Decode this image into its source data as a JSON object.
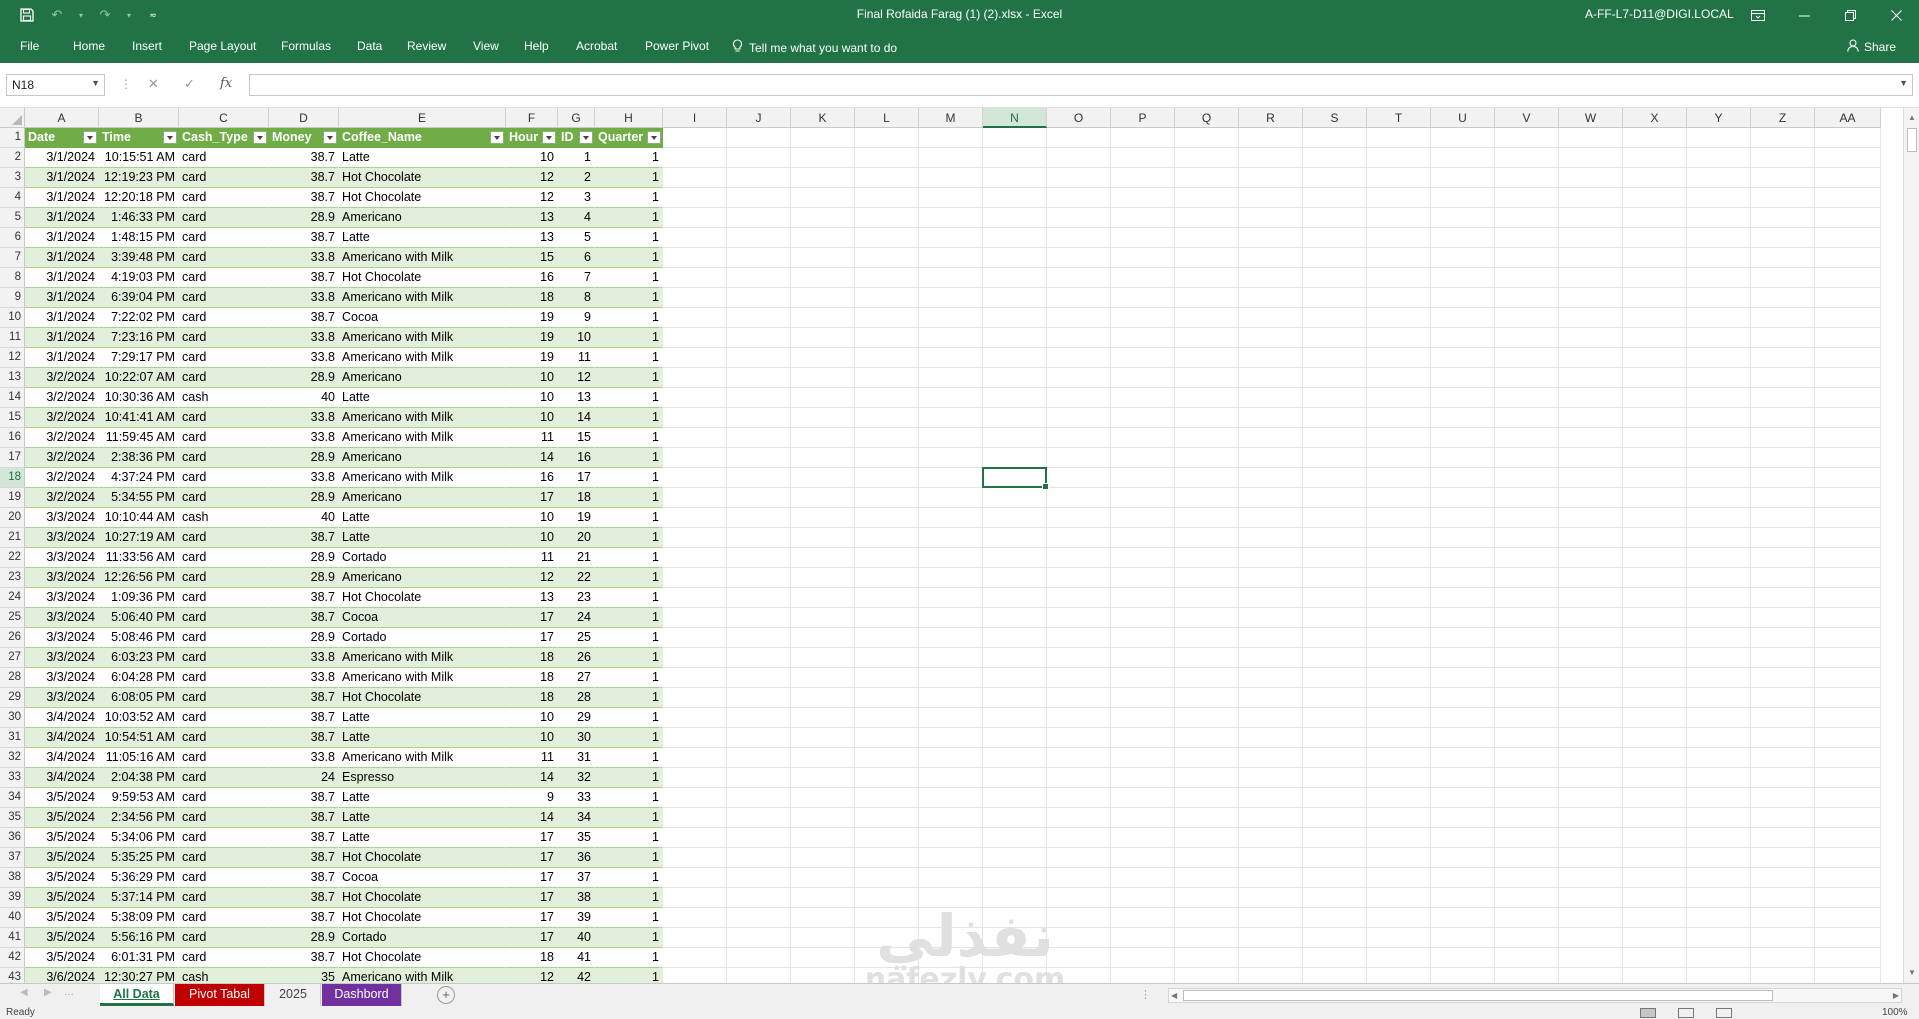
{
  "window": {
    "title": "Final Rofaida Farag (1) (2).xlsx  -  Excel",
    "user": "A-FF-L7-D11@DIGI.LOCAL"
  },
  "ribbon": {
    "tabs": [
      "File",
      "Home",
      "Insert",
      "Page Layout",
      "Formulas",
      "Data",
      "Review",
      "View",
      "Help",
      "Acrobat",
      "Power Pivot"
    ],
    "tell_me": "Tell me what you want to do",
    "share": "Share"
  },
  "formula_bar": {
    "name_box": "N18",
    "formula": ""
  },
  "columns": [
    "A",
    "B",
    "C",
    "D",
    "E",
    "F",
    "G",
    "H",
    "I",
    "J",
    "K",
    "L",
    "M",
    "N",
    "O",
    "P",
    "Q",
    "R",
    "S",
    "T",
    "U",
    "V",
    "W",
    "X",
    "Y",
    "Z",
    "AA"
  ],
  "selected_cell": "N18",
  "table": {
    "headers": [
      "Date",
      "Time",
      "Cash_Type",
      "Money",
      "Coffee_Name",
      "Hour",
      "ID",
      "Quarter"
    ],
    "rows": [
      [
        "3/1/2024",
        "10:15:51 AM",
        "card",
        "38.7",
        "Latte",
        "10",
        "1",
        "1"
      ],
      [
        "3/1/2024",
        "12:19:23 PM",
        "card",
        "38.7",
        "Hot Chocolate",
        "12",
        "2",
        "1"
      ],
      [
        "3/1/2024",
        "12:20:18 PM",
        "card",
        "38.7",
        "Hot Chocolate",
        "12",
        "3",
        "1"
      ],
      [
        "3/1/2024",
        "1:46:33 PM",
        "card",
        "28.9",
        "Americano",
        "13",
        "4",
        "1"
      ],
      [
        "3/1/2024",
        "1:48:15 PM",
        "card",
        "38.7",
        "Latte",
        "13",
        "5",
        "1"
      ],
      [
        "3/1/2024",
        "3:39:48 PM",
        "card",
        "33.8",
        "Americano with Milk",
        "15",
        "6",
        "1"
      ],
      [
        "3/1/2024",
        "4:19:03 PM",
        "card",
        "38.7",
        "Hot Chocolate",
        "16",
        "7",
        "1"
      ],
      [
        "3/1/2024",
        "6:39:04 PM",
        "card",
        "33.8",
        "Americano with Milk",
        "18",
        "8",
        "1"
      ],
      [
        "3/1/2024",
        "7:22:02 PM",
        "card",
        "38.7",
        "Cocoa",
        "19",
        "9",
        "1"
      ],
      [
        "3/1/2024",
        "7:23:16 PM",
        "card",
        "33.8",
        "Americano with Milk",
        "19",
        "10",
        "1"
      ],
      [
        "3/1/2024",
        "7:29:17 PM",
        "card",
        "33.8",
        "Americano with Milk",
        "19",
        "11",
        "1"
      ],
      [
        "3/2/2024",
        "10:22:07 AM",
        "card",
        "28.9",
        "Americano",
        "10",
        "12",
        "1"
      ],
      [
        "3/2/2024",
        "10:30:36 AM",
        "cash",
        "40",
        "Latte",
        "10",
        "13",
        "1"
      ],
      [
        "3/2/2024",
        "10:41:41 AM",
        "card",
        "33.8",
        "Americano with Milk",
        "10",
        "14",
        "1"
      ],
      [
        "3/2/2024",
        "11:59:45 AM",
        "card",
        "33.8",
        "Americano with Milk",
        "11",
        "15",
        "1"
      ],
      [
        "3/2/2024",
        "2:38:36 PM",
        "card",
        "28.9",
        "Americano",
        "14",
        "16",
        "1"
      ],
      [
        "3/2/2024",
        "4:37:24 PM",
        "card",
        "33.8",
        "Americano with Milk",
        "16",
        "17",
        "1"
      ],
      [
        "3/2/2024",
        "5:34:55 PM",
        "card",
        "28.9",
        "Americano",
        "17",
        "18",
        "1"
      ],
      [
        "3/3/2024",
        "10:10:44 AM",
        "cash",
        "40",
        "Latte",
        "10",
        "19",
        "1"
      ],
      [
        "3/3/2024",
        "10:27:19 AM",
        "card",
        "38.7",
        "Latte",
        "10",
        "20",
        "1"
      ],
      [
        "3/3/2024",
        "11:33:56 AM",
        "card",
        "28.9",
        "Cortado",
        "11",
        "21",
        "1"
      ],
      [
        "3/3/2024",
        "12:26:56 PM",
        "card",
        "28.9",
        "Americano",
        "12",
        "22",
        "1"
      ],
      [
        "3/3/2024",
        "1:09:36 PM",
        "card",
        "38.7",
        "Hot Chocolate",
        "13",
        "23",
        "1"
      ],
      [
        "3/3/2024",
        "5:06:40 PM",
        "card",
        "38.7",
        "Cocoa",
        "17",
        "24",
        "1"
      ],
      [
        "3/3/2024",
        "5:08:46 PM",
        "card",
        "28.9",
        "Cortado",
        "17",
        "25",
        "1"
      ],
      [
        "3/3/2024",
        "6:03:23 PM",
        "card",
        "33.8",
        "Americano with Milk",
        "18",
        "26",
        "1"
      ],
      [
        "3/3/2024",
        "6:04:28 PM",
        "card",
        "33.8",
        "Americano with Milk",
        "18",
        "27",
        "1"
      ],
      [
        "3/3/2024",
        "6:08:05 PM",
        "card",
        "38.7",
        "Hot Chocolate",
        "18",
        "28",
        "1"
      ],
      [
        "3/4/2024",
        "10:03:52 AM",
        "card",
        "38.7",
        "Latte",
        "10",
        "29",
        "1"
      ],
      [
        "3/4/2024",
        "10:54:51 AM",
        "card",
        "38.7",
        "Latte",
        "10",
        "30",
        "1"
      ],
      [
        "3/4/2024",
        "11:05:16 AM",
        "card",
        "33.8",
        "Americano with Milk",
        "11",
        "31",
        "1"
      ],
      [
        "3/4/2024",
        "2:04:38 PM",
        "card",
        "24",
        "Espresso",
        "14",
        "32",
        "1"
      ],
      [
        "3/5/2024",
        "9:59:53 AM",
        "card",
        "38.7",
        "Latte",
        "9",
        "33",
        "1"
      ],
      [
        "3/5/2024",
        "2:34:56 PM",
        "card",
        "38.7",
        "Latte",
        "14",
        "34",
        "1"
      ],
      [
        "3/5/2024",
        "5:34:06 PM",
        "card",
        "38.7",
        "Latte",
        "17",
        "35",
        "1"
      ],
      [
        "3/5/2024",
        "5:35:25 PM",
        "card",
        "38.7",
        "Hot Chocolate",
        "17",
        "36",
        "1"
      ],
      [
        "3/5/2024",
        "5:36:29 PM",
        "card",
        "38.7",
        "Cocoa",
        "17",
        "37",
        "1"
      ],
      [
        "3/5/2024",
        "5:37:14 PM",
        "card",
        "38.7",
        "Hot Chocolate",
        "17",
        "38",
        "1"
      ],
      [
        "3/5/2024",
        "5:38:09 PM",
        "card",
        "38.7",
        "Hot Chocolate",
        "17",
        "39",
        "1"
      ],
      [
        "3/5/2024",
        "5:56:16 PM",
        "card",
        "28.9",
        "Cortado",
        "17",
        "40",
        "1"
      ],
      [
        "3/5/2024",
        "6:01:31 PM",
        "card",
        "38.7",
        "Hot Chocolate",
        "18",
        "41",
        "1"
      ],
      [
        "3/6/2024",
        "12:30:27 PM",
        "cash",
        "35",
        "Americano with Milk",
        "12",
        "42",
        "1"
      ]
    ]
  },
  "sheets": [
    {
      "name": "All Data",
      "active": true,
      "color": "#217346"
    },
    {
      "name": "Pivot Tabal",
      "active": false,
      "color": "#c00000"
    },
    {
      "name": "2025",
      "active": false,
      "color": ""
    },
    {
      "name": "Dashbord",
      "active": false,
      "color": "#7030a0"
    }
  ],
  "status": {
    "ready": "Ready",
    "zoom": "100%"
  },
  "watermark": {
    "arabic": "نفذلي",
    "latin": "nafezly.com"
  },
  "theme": {
    "accent": "#217346",
    "table_header": "#70ad47",
    "table_band": "#e2efda"
  }
}
